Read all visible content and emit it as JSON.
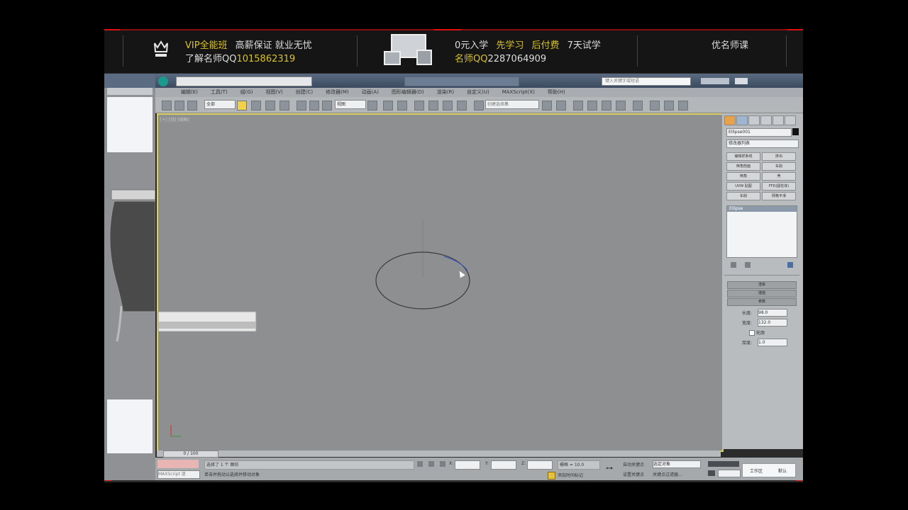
{
  "banner": {
    "line1_yellow": "VIP全能班",
    "line1_white": "高薪保证  就业无忧",
    "line2_prefix": "了解名师QQ",
    "line2_qq": "1015862319",
    "promo_line1_white": "0元入学",
    "promo_line1_yellow1": "先学习",
    "promo_line1_yellow2": "后付费",
    "promo_line1_white2": "7天试学",
    "promo_line2_prefix": "名师QQ",
    "promo_line2_qq": "2287064909",
    "logo_text": "优名师课",
    "icon_name": "crown-icon"
  },
  "app": {
    "search_placeholder": "键入关键字或短语",
    "menu": [
      "编辑(E)",
      "工具(T)",
      "组(G)",
      "视图(V)",
      "创建(C)",
      "修改器(M)",
      "动画(A)",
      "图形编辑器(D)",
      "渲染(R)",
      "自定义(U)",
      "MAXScript(X)",
      "帮助(H)"
    ],
    "toolbar_dropdown1": "全部",
    "toolbar_dropdown2": "视图",
    "toolbar_dropdown3": "创建选择集",
    "viewport_label": "[+] [顶] [线框]",
    "object_name": "Ellipse001",
    "modifier_list": "修改器列表",
    "cmd_buttons": [
      "编辑样条线",
      "挤出",
      "倒角剖面",
      "车削",
      "倒角",
      "壳",
      "UVW 贴图",
      "FFD(圆柱体)",
      "车削",
      "网格平滑"
    ],
    "stack_item": "Ellipse",
    "rollouts": [
      "渲染",
      "插值",
      "参数"
    ],
    "params": {
      "length_label": "长度:",
      "length_value": "98.0",
      "width_label": "宽度:",
      "width_value": "132.0",
      "outline_label": "轮廓",
      "thickness_label": "厚度:",
      "thickness_value": "1.0"
    },
    "timeline": "0 / 100",
    "status_selected": "选择了 1 个 图形",
    "status_hint": "单击并拖动以选择并移动对象",
    "maxscript": "MAXScript 迷",
    "grid": "栅格 = 10.0",
    "autokey": "自动关键点",
    "setkey": "设置关键点",
    "selected": "选定对象",
    "keyfilter": "关键点过滤器...",
    "addtime": "添加时间标记",
    "x_label": "X:",
    "y_label": "Y:",
    "z_label": "Z:",
    "workspace_label": "工作区",
    "workspace_value": "默认"
  },
  "colors": {
    "accent_yellow": "#d9c22a",
    "viewport_bg": "#8e8f91",
    "frame_red": "#e01010"
  }
}
